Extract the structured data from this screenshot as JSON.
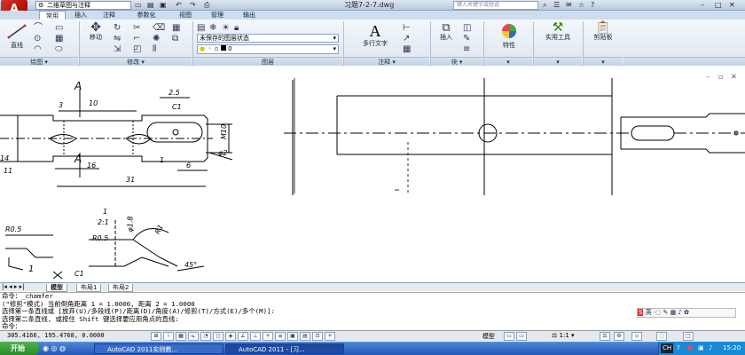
{
  "app": {
    "logo": "A"
  },
  "titlebar": {
    "workspace": "二维草图与注释",
    "doc_title": "习题7-2-7.dwg",
    "search_placeholder": "键入关键字或短语"
  },
  "tabs": [
    "常用",
    "插入",
    "注释",
    "参数化",
    "视图",
    "管理",
    "输出"
  ],
  "ribbon": {
    "draw": {
      "line": "直线",
      "panel": "绘图 ▾"
    },
    "modify": {
      "move": "移动",
      "panel": "修改 ▾"
    },
    "layers": {
      "state": "未保存的图层状态",
      "current_layer": "0",
      "panel": "图层"
    },
    "annotation": {
      "multiline_text": "多行文字",
      "panel": "注释 ▾"
    },
    "block": {
      "insert": "插入",
      "panel": "块 ▾"
    },
    "properties": {
      "label": "特性"
    },
    "utilities": {
      "label": "实用工具"
    },
    "clipboard": {
      "label": "剪贴板"
    }
  },
  "drawing": {
    "dims_left": [
      "A",
      "3",
      "10",
      "2.5",
      "C1",
      "M10",
      "A",
      "16",
      "1",
      "6",
      "φ2",
      "31",
      "14",
      "11",
      "R0.5",
      "1",
      "2:1",
      "φ1.8",
      "R1",
      "R0.5",
      "45°",
      "1",
      "C1"
    ]
  },
  "layout_tabs": [
    "模型",
    "布局1",
    "布局2"
  ],
  "command_lines": [
    "命令：_chamfer",
    "(\"修剪\"模式) 当前倒角距离 1 = 1.0000, 距离 2 = 1.0000",
    "选择第一条直线或 [放弃(U)/多段线(P)/距离(D)/角度(A)/修剪(T)/方式(E)/多个(M)]:",
    "选择第二条直线, 或按住 Shift 键选择要应用角点的直线:",
    "命令："
  ],
  "ime": {
    "label": "英"
  },
  "status": {
    "coords": "305.4166, 195.4768, 0.0000",
    "model": "模型",
    "scale": "1:1"
  },
  "taskbar": {
    "start": "开始",
    "tasks": [
      "AutoCAD 2011实例教...",
      "AutoCAD 2011 - [习..."
    ],
    "lang": "CH",
    "time": "15:20"
  }
}
